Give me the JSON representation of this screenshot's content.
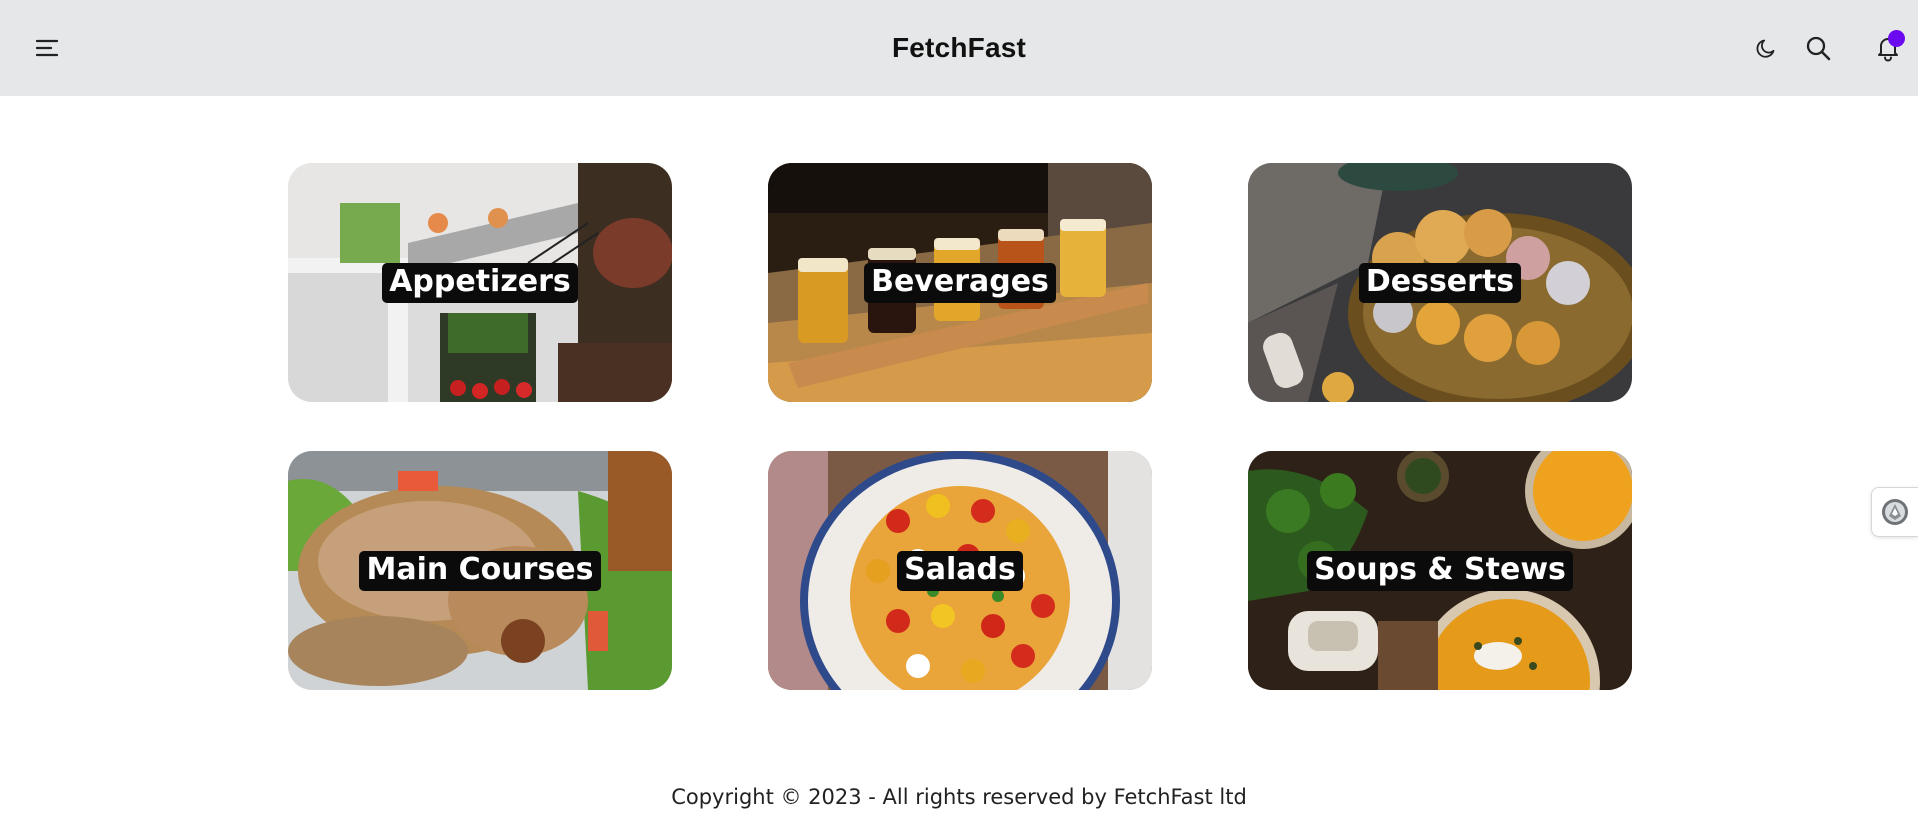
{
  "header": {
    "brand": "FetchFast",
    "menu_icon": "menu-icon",
    "theme_icon": "moon-icon",
    "search_icon": "search-icon",
    "notifications_icon": "bell-icon",
    "badge_color": "#6b0af0"
  },
  "categories": [
    {
      "label": "Appetizers"
    },
    {
      "label": "Beverages"
    },
    {
      "label": "Desserts"
    },
    {
      "label": "Main Courses"
    },
    {
      "label": "Salads"
    },
    {
      "label": "Soups & Stews"
    }
  ],
  "footer": {
    "copyright": "Copyright © 2023 - All rights reserved by FetchFast ltd"
  },
  "side_widget": {
    "icon": "assistant-icon"
  }
}
